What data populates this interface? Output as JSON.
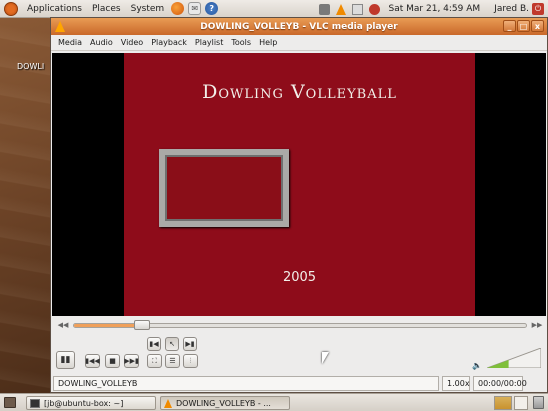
{
  "top_panel": {
    "menus": [
      "Applications",
      "Places",
      "System"
    ],
    "clock": "Sat Mar 21,  4:59 AM",
    "user": "Jared B."
  },
  "desktop": {
    "icon_label": "DOWLI"
  },
  "window": {
    "title": "DOWLING_VOLLEYB - VLC media player",
    "buttons": [
      "_",
      "□",
      "x"
    ]
  },
  "menu_bar": [
    "Media",
    "Audio",
    "Video",
    "Playback",
    "Playlist",
    "Tools",
    "Help"
  ],
  "video": {
    "title": "Dowling Volleyball",
    "year": "2005"
  },
  "seek": {
    "position_fraction": 0.15
  },
  "volume": {
    "level_fraction": 0.4
  },
  "status": {
    "filename": "DOWLING_VOLLEYB",
    "speed": "1.00x",
    "time": "00:00/00:00"
  },
  "taskbar": {
    "tasks": [
      "[jb@ubuntu-box: ~]",
      "DOWLING_VOLLEYB - ..."
    ]
  },
  "colors": {
    "title_bar": "#d47a3a",
    "video_bg": "#8e0c1a",
    "seek_fill": "#f0a05a"
  }
}
